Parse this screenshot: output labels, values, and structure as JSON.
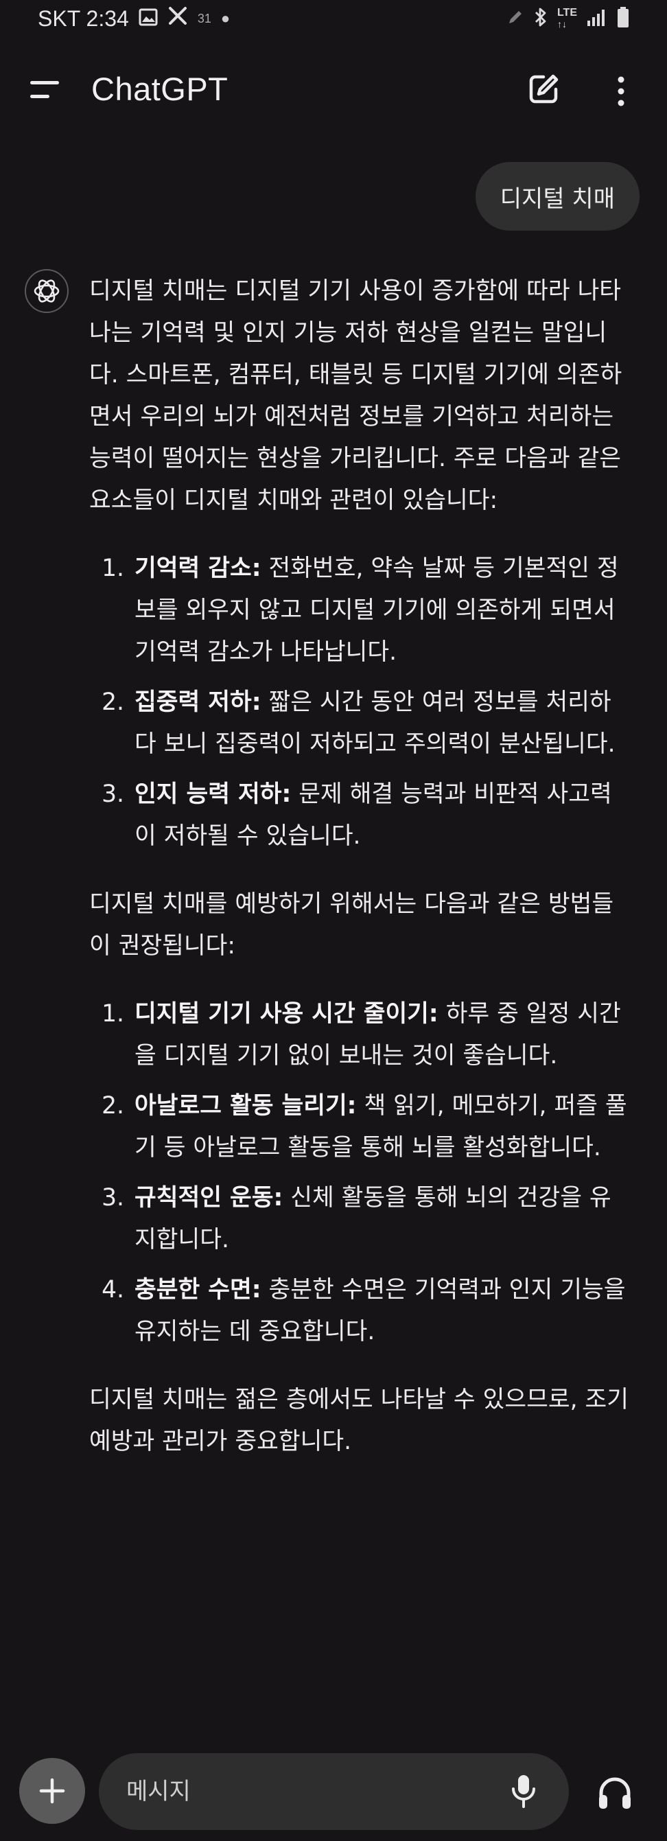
{
  "status_bar": {
    "carrier_time": "SKT 2:34",
    "calendar_badge": "31",
    "network": "LTE"
  },
  "header": {
    "title": "ChatGPT"
  },
  "conversation": {
    "user_message": "디지털 치매",
    "assistant": {
      "intro": "디지털 치매는 디지털 기기 사용이 증가함에 따라 나타나는 기억력 및 인지 기능 저하 현상을 일컫는 말입니다. 스마트폰, 컴퓨터, 태블릿 등 디지털 기기에 의존하면서 우리의 뇌가 예전처럼 정보를 기억하고 처리하는 능력이 떨어지는 현상을 가리킵니다. 주로 다음과 같은 요소들이 디지털 치매와 관련이 있습니다:",
      "factors": [
        {
          "title": "기억력 감소:",
          "text": " 전화번호, 약속 날짜 등 기본적인 정보를 외우지 않고 디지털 기기에 의존하게 되면서 기억력 감소가 나타납니다."
        },
        {
          "title": "집중력 저하:",
          "text": " 짧은 시간 동안 여러 정보를 처리하다 보니 집중력이 저하되고 주의력이 분산됩니다."
        },
        {
          "title": "인지 능력 저하:",
          "text": " 문제 해결 능력과 비판적 사고력이 저하될 수 있습니다."
        }
      ],
      "prevention_intro": "디지털 치매를 예방하기 위해서는 다음과 같은 방법들이 권장됩니다:",
      "methods": [
        {
          "title": "디지털 기기 사용 시간 줄이기:",
          "text": " 하루 중 일정 시간을 디지털 기기 없이 보내는 것이 좋습니다."
        },
        {
          "title": "아날로그 활동 늘리기:",
          "text": " 책 읽기, 메모하기, 퍼즐 풀기 등 아날로그 활동을 통해 뇌를 활성화합니다."
        },
        {
          "title": "규칙적인 운동:",
          "text": " 신체 활동을 통해 뇌의 건강을 유지합니다."
        },
        {
          "title": "충분한 수면:",
          "text": " 충분한 수면은 기억력과 인지 기능을 유지하는 데 중요합니다."
        }
      ],
      "conclusion": "디지털 치매는 젊은 층에서도 나타날 수 있으므로, 조기 예방과 관리가 중요합니다."
    }
  },
  "composer": {
    "placeholder": "메시지"
  },
  "icons": {
    "status_left": [
      "image-icon",
      "tools-icon",
      "calendar-icon",
      "dot-icon"
    ],
    "status_right": [
      "pen-icon",
      "bluetooth-icon",
      "lte-icon",
      "signal-icon",
      "battery-icon"
    ],
    "header": [
      "menu-icon",
      "new-chat-icon",
      "more-icon"
    ],
    "assistant": "openai-logo-icon",
    "composer": [
      "plus-icon",
      "mic-icon",
      "headphones-icon"
    ]
  },
  "colors": {
    "background": "#171417",
    "user_bubble": "#2f2f2f",
    "input_background": "#2e2e2e",
    "plus_button": "#5a5a5a",
    "text": "#ececec"
  }
}
